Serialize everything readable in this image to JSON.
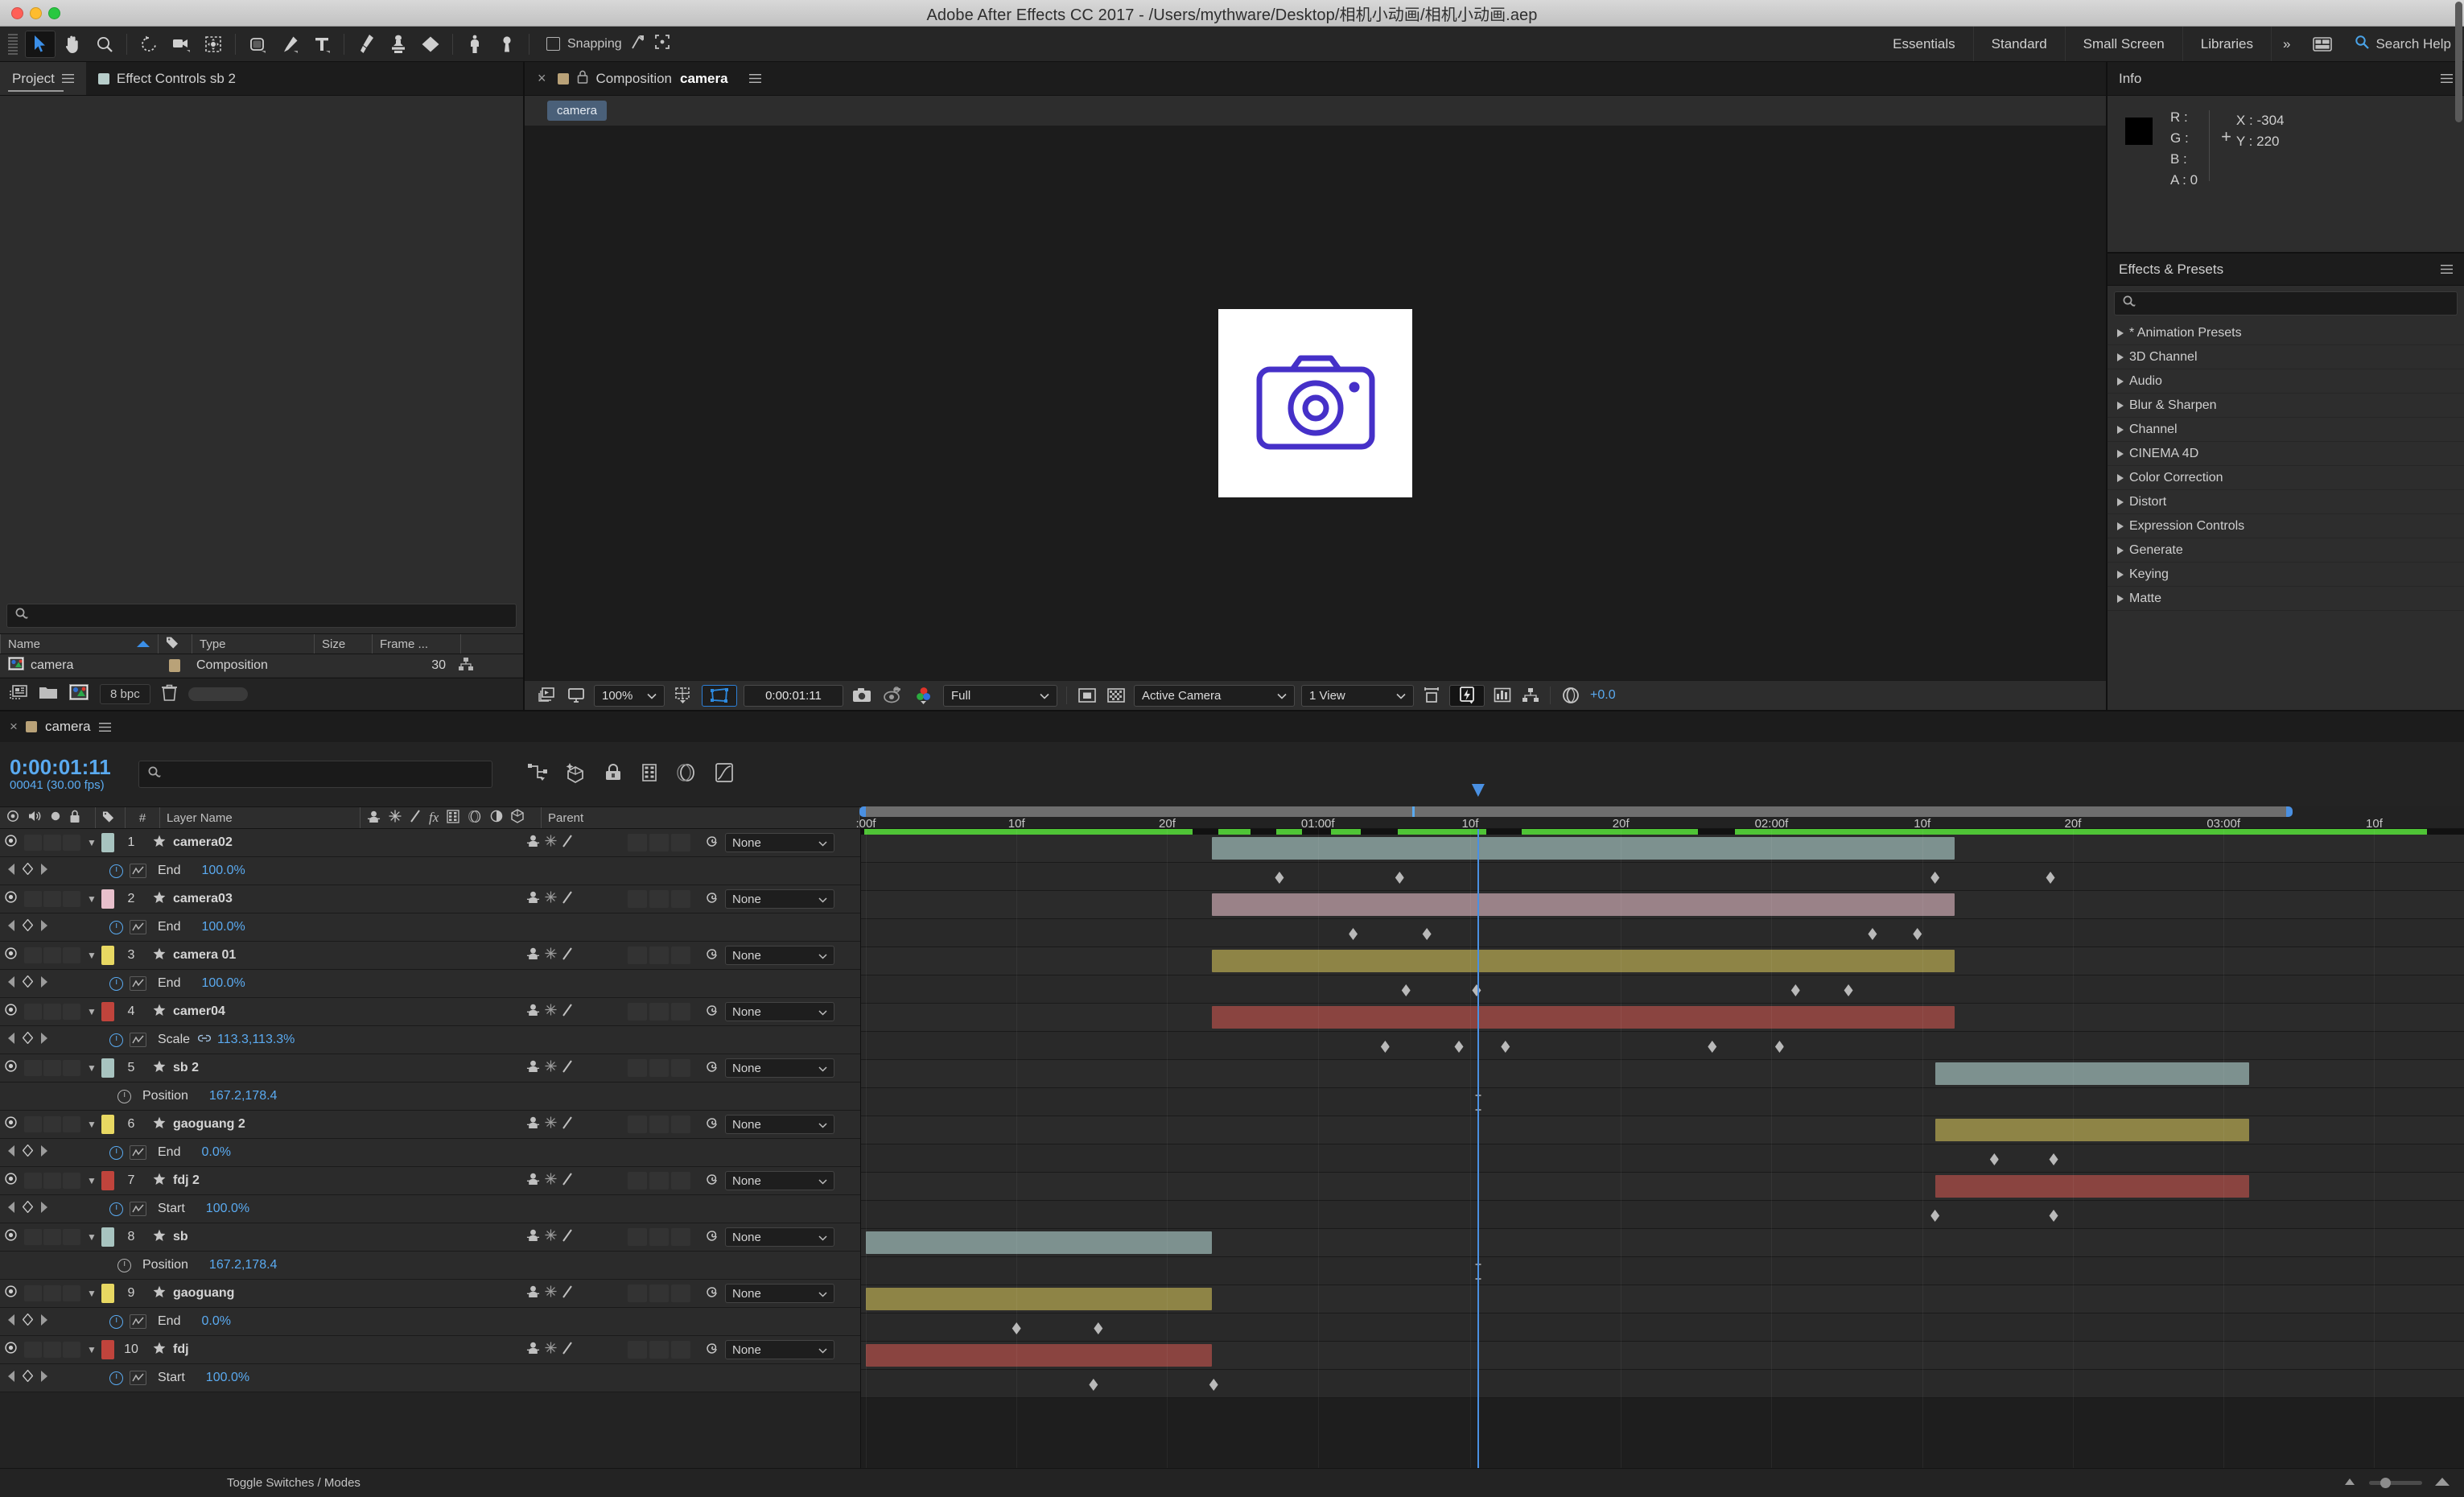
{
  "window": {
    "title": "Adobe After Effects CC 2017 - /Users/mythware/Desktop/相机小动画/相机小动画.aep"
  },
  "toolbar": {
    "tools": [
      "selection-tool",
      "hand-tool",
      "zoom-tool",
      "rotation-tool",
      "camera-tool",
      "pan-behind-tool",
      "shape-tool",
      "pen-tool",
      "type-tool",
      "brush-tool",
      "clone-stamp-tool",
      "eraser-tool",
      "roto-brush-tool",
      "puppet-pin-tool"
    ],
    "snapping_label": "Snapping",
    "workspaces": [
      "Essentials",
      "Standard",
      "Small Screen",
      "Libraries"
    ],
    "more_label": "»",
    "search_help_placeholder": "Search Help"
  },
  "project_panel": {
    "tabs": [
      {
        "label": "Project",
        "selected": true
      },
      {
        "label": "Effect Controls sb 2",
        "selected": false
      }
    ],
    "search_placeholder": "",
    "columns": [
      "Name",
      "",
      "Type",
      "Size",
      "Frame ..."
    ],
    "items": [
      {
        "name": "camera",
        "type": "Composition",
        "size": "",
        "frame_rate": "30"
      }
    ],
    "footer": {
      "bpc": "8 bpc"
    }
  },
  "comp_panel": {
    "tab_label": "Composition",
    "tab_name": "camera",
    "chip_label": "camera",
    "footer": {
      "zoom": "100%",
      "timecode": "0:00:01:11",
      "resolution": "Full",
      "view_layout": "Active Camera",
      "views": "1 View",
      "exposure": "+0.0"
    }
  },
  "info_panel": {
    "title": "Info",
    "r_label": "R :",
    "r_value": "",
    "g_label": "G :",
    "g_value": "",
    "b_label": "B :",
    "b_value": "",
    "a_label": "A :",
    "a_value": "0",
    "x_label": "X :",
    "x_value": "-304",
    "y_label": "Y :",
    "y_value": "220",
    "swatch_color": "#000000"
  },
  "effects_panel": {
    "title": "Effects & Presets",
    "search_placeholder": "",
    "items": [
      "* Animation Presets",
      "3D Channel",
      "Audio",
      "Blur & Sharpen",
      "Channel",
      "CINEMA 4D",
      "Color Correction",
      "Distort",
      "Expression Controls",
      "Generate",
      "Keying",
      "Matte"
    ]
  },
  "timeline": {
    "tab_label": "camera",
    "current_time": "0:00:01:11",
    "frame_info": "00041 (30.00 fps)",
    "search_placeholder": "",
    "column_headers": {
      "number": "#",
      "layer_name": "Layer Name",
      "parent": "Parent"
    },
    "ruler_ticks": [
      {
        "label": ":00f",
        "pos": 0.3
      },
      {
        "label": "10f",
        "pos": 9.7
      },
      {
        "label": "20f",
        "pos": 19.1
      },
      {
        "label": "01:00f",
        "pos": 28.5
      },
      {
        "label": "10f",
        "pos": 38.0
      },
      {
        "label": "20f",
        "pos": 47.4
      },
      {
        "label": "02:00f",
        "pos": 56.8
      },
      {
        "label": "10f",
        "pos": 66.2
      },
      {
        "label": "20f",
        "pos": 75.6
      },
      {
        "label": "03:00f",
        "pos": 85.0
      },
      {
        "label": "10f",
        "pos": 94.4
      }
    ],
    "playhead_pos": 38.5,
    "work_area_end": 89.0,
    "rows": [
      {
        "kind": "layer",
        "num": "1",
        "name": "camera02",
        "color": "#a8c4c0",
        "parent": "None",
        "clip": {
          "start": 21.9,
          "end": 68.2,
          "color": "#7d918f"
        }
      },
      {
        "kind": "prop",
        "name": "End",
        "value": "100.0%",
        "animated": true,
        "keys": [
          26.1,
          33.6,
          67.0,
          74.2
        ]
      },
      {
        "kind": "layer",
        "num": "2",
        "name": "camera03",
        "color": "#e8c0cc",
        "parent": "None",
        "clip": {
          "start": 21.9,
          "end": 68.2,
          "color": "#9a8288"
        }
      },
      {
        "kind": "prop",
        "name": "End",
        "value": "100.0%",
        "animated": true,
        "keys": [
          30.7,
          35.3,
          63.1,
          65.9
        ]
      },
      {
        "kind": "layer",
        "num": "3",
        "name": "camera 01",
        "color": "#e8d862",
        "parent": "None",
        "clip": {
          "start": 21.9,
          "end": 68.2,
          "color": "#8e8446"
        }
      },
      {
        "kind": "prop",
        "name": "End",
        "value": "100.0%",
        "animated": true,
        "keys": [
          34.0,
          38.4,
          58.3,
          61.6
        ]
      },
      {
        "kind": "layer",
        "num": "4",
        "name": "camer04",
        "color": "#c0443c",
        "parent": "None",
        "clip": {
          "start": 21.9,
          "end": 68.2,
          "color": "#8a4440"
        }
      },
      {
        "kind": "prop",
        "name": "Scale",
        "value": "113.3,113.3%",
        "animated": true,
        "linked": true,
        "keys": [
          32.7,
          37.3,
          40.2,
          53.1,
          57.3
        ]
      },
      {
        "kind": "layer",
        "num": "5",
        "name": "sb 2",
        "color": "#a8c4c0",
        "parent": "None",
        "clip": {
          "start": 67.0,
          "end": 86.6,
          "color": "#7d918f"
        }
      },
      {
        "kind": "prop",
        "name": "Position",
        "value": "167.2,178.4",
        "animated": false,
        "ibeam": 38.5
      },
      {
        "kind": "layer",
        "num": "6",
        "name": "gaoguang 2",
        "color": "#e8d862",
        "parent": "None",
        "clip": {
          "start": 67.0,
          "end": 86.6,
          "color": "#8e8446"
        }
      },
      {
        "kind": "prop",
        "name": "End",
        "value": "0.0%",
        "animated": true,
        "keys": [
          70.7,
          74.4
        ]
      },
      {
        "kind": "layer",
        "num": "7",
        "name": "fdj 2",
        "color": "#c0443c",
        "parent": "None",
        "clip": {
          "start": 67.0,
          "end": 86.6,
          "color": "#8a4440"
        }
      },
      {
        "kind": "prop",
        "name": "Start",
        "value": "100.0%",
        "animated": true,
        "keys": [
          67.0,
          74.4
        ]
      },
      {
        "kind": "layer",
        "num": "8",
        "name": "sb",
        "color": "#a8c4c0",
        "parent": "None",
        "clip": {
          "start": 0.3,
          "end": 21.9,
          "color": "#7d918f"
        }
      },
      {
        "kind": "prop",
        "name": "Position",
        "value": "167.2,178.4",
        "animated": false,
        "ibeam": 38.5
      },
      {
        "kind": "layer",
        "num": "9",
        "name": "gaoguang",
        "color": "#e8d862",
        "parent": "None",
        "clip": {
          "start": 0.3,
          "end": 21.9,
          "color": "#8e8446"
        }
      },
      {
        "kind": "prop",
        "name": "End",
        "value": "0.0%",
        "animated": true,
        "keys": [
          9.7,
          14.8
        ]
      },
      {
        "kind": "layer",
        "num": "10",
        "name": "fdj",
        "color": "#c0443c",
        "parent": "None",
        "clip": {
          "start": 0.3,
          "end": 21.9,
          "color": "#8a4440"
        }
      },
      {
        "kind": "prop",
        "name": "Start",
        "value": "100.0%",
        "animated": true,
        "keys": [
          14.5,
          22.0
        ]
      }
    ],
    "green_segments": [
      {
        "start": 0.2,
        "width": 20.5
      },
      {
        "start": 22.3,
        "width": 2.0
      },
      {
        "start": 25.9,
        "width": 1.6
      },
      {
        "start": 29.3,
        "width": 1.9
      },
      {
        "start": 33.5,
        "width": 5.5
      },
      {
        "start": 41.2,
        "width": 11.0
      },
      {
        "start": 54.5,
        "width": 41.5
      },
      {
        "start": 63.5,
        "width": 1.3
      },
      {
        "start": 66.7,
        "width": 1.3
      },
      {
        "start": 69.9,
        "width": 1.3
      },
      {
        "start": 72.7,
        "width": 25.0
      }
    ],
    "footer": {
      "toggle_label": "Toggle Switches / Modes"
    }
  }
}
